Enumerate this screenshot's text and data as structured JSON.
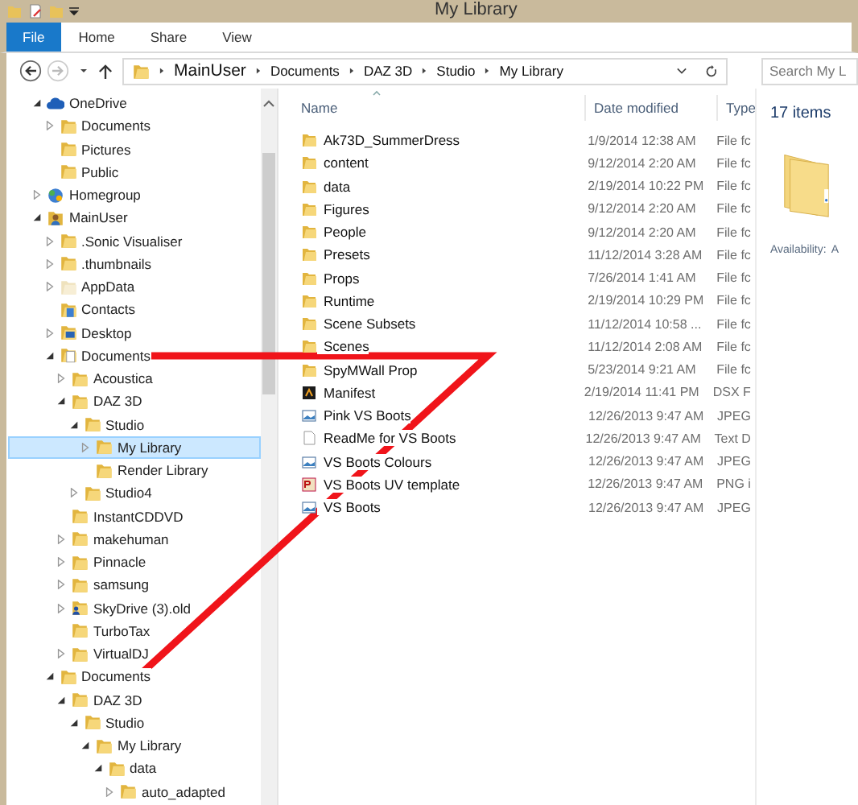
{
  "window": {
    "title": "My Library"
  },
  "ribbon_tabs": [
    {
      "label": "File",
      "kind": "app"
    },
    {
      "label": "Home",
      "kind": "tab"
    },
    {
      "label": "Share",
      "kind": "tab"
    },
    {
      "label": "View",
      "kind": "tab"
    }
  ],
  "address_bar": {
    "path": [
      {
        "label": "MainUser",
        "kind": "root"
      },
      {
        "label": "Documents",
        "kind": "part"
      },
      {
        "label": "DAZ 3D",
        "kind": "part"
      },
      {
        "label": "Studio",
        "kind": "part"
      },
      {
        "label": "My Library",
        "kind": "part"
      }
    ]
  },
  "search": {
    "placeholder": "Search My L"
  },
  "navigation_tree": [
    {
      "label": "OneDrive",
      "kind": "cloud",
      "expanded": true,
      "selected": false,
      "children": [
        {
          "label": "Documents",
          "kind": "folder",
          "expanded": false,
          "selected": false
        },
        {
          "label": "Pictures",
          "kind": "folder",
          "selected": false
        },
        {
          "label": "Public",
          "kind": "folder",
          "selected": false
        }
      ]
    },
    {
      "label": "Homegroup",
      "kind": "homegroup",
      "expanded": false,
      "selected": false
    },
    {
      "label": "MainUser",
      "kind": "user",
      "expanded": true,
      "selected": false,
      "children": [
        {
          "label": ".Sonic Visualiser",
          "kind": "folder",
          "expanded": false,
          "selected": false
        },
        {
          "label": ".thumbnails",
          "kind": "folder",
          "expanded": false,
          "selected": false
        },
        {
          "label": "AppData",
          "kind": "hidden",
          "expanded": false,
          "selected": false
        },
        {
          "label": "Contacts",
          "kind": "contacts",
          "selected": false
        },
        {
          "label": "Desktop",
          "kind": "desktop",
          "expanded": false,
          "selected": false
        },
        {
          "label": "Documents",
          "kind": "documents",
          "expanded": true,
          "selected": false,
          "children": [
            {
              "label": "Acoustica",
              "kind": "folder",
              "expanded": false,
              "selected": false
            },
            {
              "label": "DAZ 3D",
              "kind": "folder",
              "expanded": true,
              "selected": false,
              "children": [
                {
                  "label": "Studio",
                  "kind": "folder",
                  "expanded": true,
                  "selected": false,
                  "children": [
                    {
                      "label": "My Library",
                      "kind": "folder",
                      "expanded": false,
                      "selected": true
                    },
                    {
                      "label": "Render Library",
                      "kind": "folder",
                      "selected": false
                    }
                  ]
                },
                {
                  "label": "Studio4",
                  "kind": "folder",
                  "expanded": false,
                  "selected": false
                }
              ]
            },
            {
              "label": "InstantCDDVD",
              "kind": "folder",
              "selected": false
            },
            {
              "label": "makehuman",
              "kind": "folder",
              "expanded": false,
              "selected": false
            },
            {
              "label": "Pinnacle",
              "kind": "folder",
              "expanded": false,
              "selected": false
            },
            {
              "label": "samsung",
              "kind": "folder",
              "expanded": false,
              "selected": false
            },
            {
              "label": "SkyDrive (3).old",
              "kind": "userfolder",
              "expanded": false,
              "selected": false
            },
            {
              "label": "TurboTax",
              "kind": "folder",
              "selected": false
            },
            {
              "label": "VirtualDJ",
              "kind": "folder",
              "expanded": false,
              "selected": false
            }
          ]
        },
        {
          "label": "Documents",
          "kind": "folder",
          "expanded": true,
          "selected": false,
          "children": [
            {
              "label": "DAZ 3D",
              "kind": "folder",
              "expanded": true,
              "selected": false,
              "children": [
                {
                  "label": "Studio",
                  "kind": "folder",
                  "expanded": true,
                  "selected": false,
                  "children": [
                    {
                      "label": "My Library",
                      "kind": "folder",
                      "expanded": true,
                      "selected": false,
                      "children": [
                        {
                          "label": "data",
                          "kind": "folder",
                          "expanded": true,
                          "selected": false,
                          "children": [
                            {
                              "label": "auto_adapted",
                              "kind": "folder",
                              "expanded": false,
                              "selected": false
                            }
                          ]
                        }
                      ]
                    }
                  ]
                }
              ]
            }
          ]
        }
      ]
    }
  ],
  "file_list": {
    "columns": [
      "Name",
      "Date modified",
      "Type"
    ],
    "rows": [
      {
        "name": "Ak73D_SummerDress",
        "date": "1/9/2014 12:38 AM",
        "type": "File fc",
        "kind": "folder"
      },
      {
        "name": "content",
        "date": "9/12/2014 2:20 AM",
        "type": "File fc",
        "kind": "folder"
      },
      {
        "name": "data",
        "date": "2/19/2014 10:22 PM",
        "type": "File fc",
        "kind": "folder"
      },
      {
        "name": "Figures",
        "date": "9/12/2014 2:20 AM",
        "type": "File fc",
        "kind": "folder"
      },
      {
        "name": "People",
        "date": "9/12/2014 2:20 AM",
        "type": "File fc",
        "kind": "folder"
      },
      {
        "name": "Presets",
        "date": "11/12/2014 3:28 AM",
        "type": "File fc",
        "kind": "folder"
      },
      {
        "name": "Props",
        "date": "7/26/2014 1:41 AM",
        "type": "File fc",
        "kind": "folder"
      },
      {
        "name": "Runtime",
        "date": "2/19/2014 10:29 PM",
        "type": "File fc",
        "kind": "folder"
      },
      {
        "name": "Scene Subsets",
        "date": "11/12/2014 10:58 ...",
        "type": "File fc",
        "kind": "folder"
      },
      {
        "name": "Scenes",
        "date": "11/12/2014 2:08 AM",
        "type": "File fc",
        "kind": "folder"
      },
      {
        "name": "SpyMWall Prop",
        "date": "5/23/2014 9:21 AM",
        "type": "File fc",
        "kind": "folder"
      },
      {
        "name": "Manifest",
        "date": "2/19/2014 11:41 PM",
        "type": "DSX F",
        "kind": "dsx"
      },
      {
        "name": "Pink VS Boots",
        "date": "12/26/2013 9:47 AM",
        "type": "JPEG",
        "kind": "image"
      },
      {
        "name": "ReadMe for VS Boots",
        "date": "12/26/2013 9:47 AM",
        "type": "Text D",
        "kind": "text"
      },
      {
        "name": "VS Boots Colours",
        "date": "12/26/2013 9:47 AM",
        "type": "JPEG",
        "kind": "image"
      },
      {
        "name": "VS Boots UV template",
        "date": "12/26/2013 9:47 AM",
        "type": "PNG i",
        "kind": "png"
      },
      {
        "name": "VS Boots",
        "date": "12/26/2013 9:47 AM",
        "type": "JPEG",
        "kind": "image"
      }
    ]
  },
  "details_pane": {
    "item_count": "17 items",
    "availability_label": "Availability:",
    "availability_value": "A"
  }
}
